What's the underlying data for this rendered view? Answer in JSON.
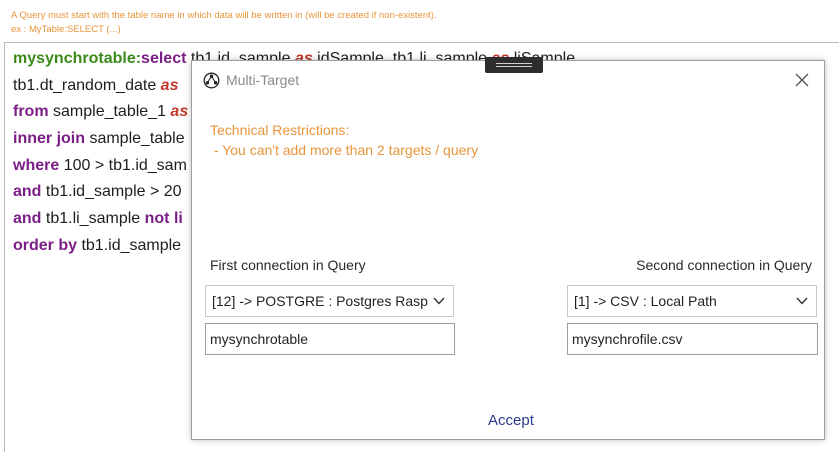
{
  "hint": {
    "line1": "A Query must start with the table name in which data will be written in (will be created if non-existent).",
    "line2": " ex : MyTable:SELECT (...)"
  },
  "editor": {
    "lines": [
      [
        {
          "t": "mysynchrotable:",
          "c": "tbl"
        },
        {
          "t": "select",
          "c": "kw"
        },
        {
          "t": " tb1.id_sample ",
          "c": ""
        },
        {
          "t": "as",
          "c": "as"
        },
        {
          "t": " idSample, tb1.li_sample ",
          "c": ""
        },
        {
          "t": "as",
          "c": "as"
        },
        {
          "t": " liSample,",
          "c": ""
        }
      ],
      [
        {
          "t": "tb1.dt_random_date ",
          "c": ""
        },
        {
          "t": "as",
          "c": "as"
        }
      ],
      [
        {
          "t": "from",
          "c": "kw"
        },
        {
          "t": " sample_table_1 ",
          "c": ""
        },
        {
          "t": "as",
          "c": "as"
        }
      ],
      [
        {
          "t": "inner join",
          "c": "kw"
        },
        {
          "t": " sample_table",
          "c": ""
        }
      ],
      [
        {
          "t": "where",
          "c": "kw"
        },
        {
          "t": " 100 > tb1.id_sam",
          "c": ""
        }
      ],
      [
        {
          "t": "and",
          "c": "kw"
        },
        {
          "t": " tb1.id_sample > 20",
          "c": ""
        }
      ],
      [
        {
          "t": "and",
          "c": "kw"
        },
        {
          "t": " tb1.li_sample ",
          "c": ""
        },
        {
          "t": "not li",
          "c": "kw"
        }
      ],
      [
        {
          "t": "order by",
          "c": "kw"
        },
        {
          "t": " tb1.id_sample",
          "c": ""
        }
      ]
    ]
  },
  "dialog": {
    "title": "Multi-Target",
    "restrictions_title": "Technical Restrictions:",
    "restrictions_item": " - You can't add more than 2 targets / query",
    "first_label": "First connection in Query",
    "second_label": "Second connection in Query",
    "first_connection": "[12] -> POSTGRE : Postgres Rasp",
    "second_connection": "[1] -> CSV : Local Path",
    "first_target": "mysynchrotable",
    "second_target": "mysynchrofile.csv",
    "accept_label": "Accept"
  },
  "icons": {
    "title": "connection-nodes-icon",
    "close": "close-icon",
    "dropdown": "chevron-down-icon"
  },
  "colors": {
    "hint": "#e8953a",
    "keyword": "#7b1f86",
    "table_name": "#3b8a1a",
    "alias_keyword": "#c0392b",
    "accept": "#2b3a8f"
  }
}
